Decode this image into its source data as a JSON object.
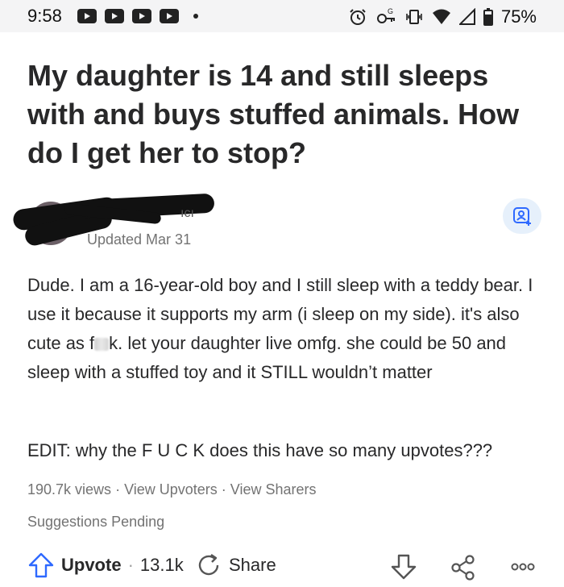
{
  "status_bar": {
    "time": "9:58",
    "battery": "75%",
    "icons_left": [
      "youtube-notification-icon",
      "youtube-notification-icon",
      "youtube-notification-icon",
      "youtube-notification-icon",
      "more-dot-icon"
    ],
    "icons_right": [
      "alarm-icon",
      "key-icon",
      "vibrate-icon",
      "wifi-icon",
      "signal-icon",
      "battery-icon"
    ]
  },
  "question": {
    "title": "My daughter is 14 and still sleeps with and buys stuffed animals. How do I get her to stop?"
  },
  "answer": {
    "author_partial": "ıcı",
    "updated": "Updated Mar 31",
    "body_pre": "Dude. I am a 16-year-old boy and I still sleep with a teddy bear. I use it because it supports my arm (i sleep on my side). it's also cute as f",
    "body_post": "k. let your daughter live omfg. she could be 50 and sleep with a stuffed toy and it STILL wouldn’t matter",
    "edit": "EDIT: why the F U C K does this have so many upvotes???",
    "views": "190.7k views",
    "view_upvoters": "View Upvoters",
    "view_sharers": "View Sharers",
    "dot_sep": " · ",
    "suggestions": "Suggestions Pending"
  },
  "actions": {
    "upvote_label": "Upvote",
    "upvote_sep": "·",
    "upvote_count": "13.1k",
    "share_label": "Share"
  },
  "colors": {
    "text": "#282829",
    "muted": "#737373",
    "accent_blue": "#2e69ff",
    "follow_bg": "#e6f0fb"
  }
}
